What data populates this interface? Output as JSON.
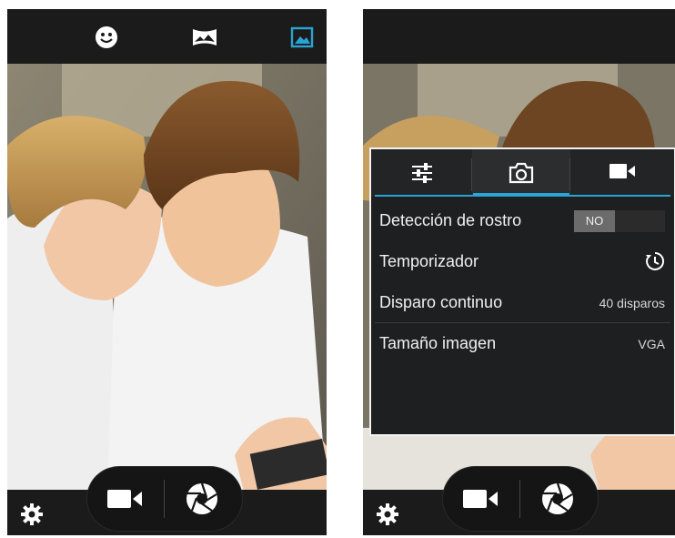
{
  "left_screen": {
    "top_icons": [
      "face-detection-icon",
      "panorama-icon",
      "gallery-icon"
    ],
    "active_top_icon_color": "#2aa4d4",
    "bottom": {
      "settings_icon": "gear-icon",
      "video_icon": "video-camera-icon",
      "shutter_icon": "shutter-icon"
    }
  },
  "right_screen": {
    "settings_panel": {
      "tabs": [
        {
          "icon": "sliders-icon",
          "active": false
        },
        {
          "icon": "camera-icon",
          "active": true
        },
        {
          "icon": "video-camera-icon",
          "active": false
        }
      ],
      "accent_color": "#2aa4d4",
      "rows": {
        "face_detection": {
          "label": "Detección de rostro",
          "value": "NO"
        },
        "timer": {
          "label": "Temporizador",
          "icon": "timer-icon"
        },
        "burst": {
          "label": "Disparo continuo",
          "value": "40 disparos"
        },
        "image_size": {
          "label": "Tamaño imagen",
          "value": "VGA"
        }
      }
    },
    "bottom": {
      "settings_icon": "gear-icon",
      "video_icon": "video-camera-icon",
      "shutter_icon": "shutter-icon"
    }
  }
}
